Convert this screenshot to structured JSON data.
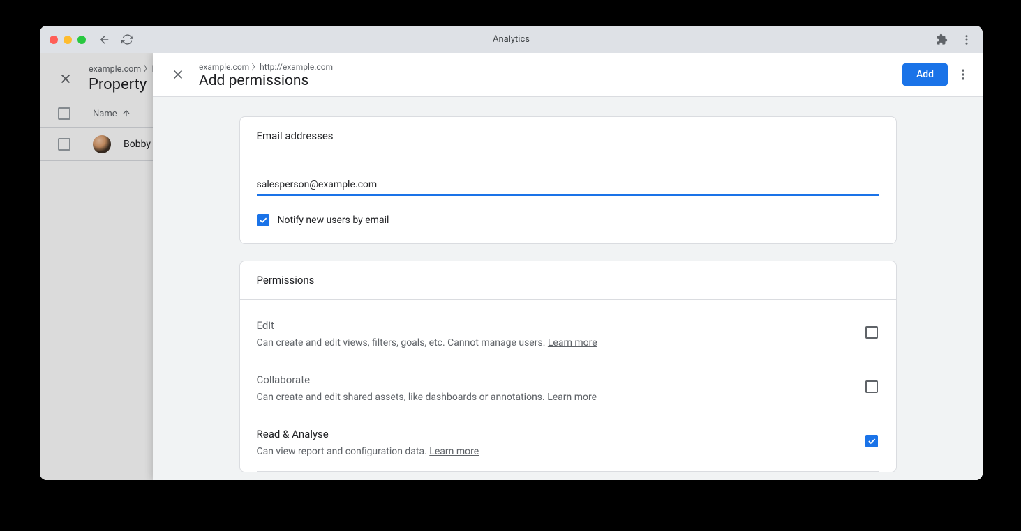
{
  "browser": {
    "title": "Analytics"
  },
  "bgPage": {
    "breadcrumb": "example.com 〉h",
    "title": "Property",
    "col_name": "Name",
    "row_name": "Bobby Ja"
  },
  "overlay": {
    "breadcrumb": "example.com 〉http://example.com",
    "title": "Add permissions",
    "add_label": "Add"
  },
  "email_card": {
    "title": "Email addresses",
    "value": "salesperson@example.com",
    "notify_label": "Notify new users by email"
  },
  "perm_card": {
    "title": "Permissions",
    "learn_more": "Learn more",
    "items": [
      {
        "name": "Edit",
        "desc": "Can create and edit views, filters, goals, etc. Cannot manage users. ",
        "checked": false,
        "active": false
      },
      {
        "name": "Collaborate",
        "desc": "Can create and edit shared assets, like dashboards or annotations. ",
        "checked": false,
        "active": false
      },
      {
        "name": "Read & Analyse",
        "desc": "Can view report and configuration data. ",
        "checked": true,
        "active": true
      }
    ]
  }
}
